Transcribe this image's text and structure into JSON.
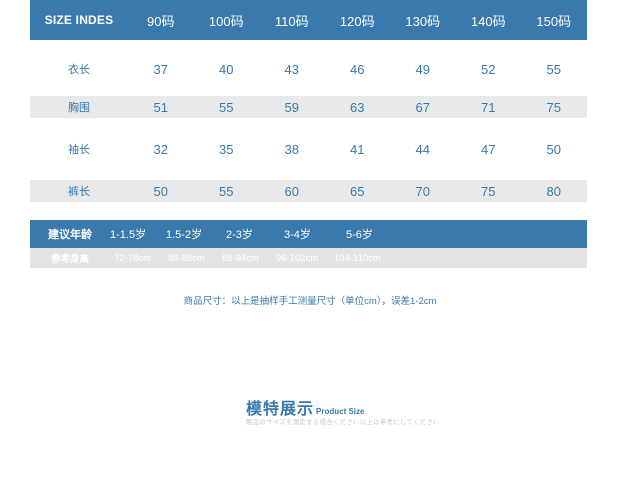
{
  "size_table": {
    "header": [
      "SIZE INDES",
      "90码",
      "100码",
      "110码",
      "120码",
      "130码",
      "140码",
      "150码"
    ],
    "rows": [
      {
        "label": "衣长",
        "values": [
          "37",
          "40",
          "43",
          "46",
          "49",
          "52",
          "55"
        ]
      },
      {
        "label": "胸围",
        "values": [
          "51",
          "55",
          "59",
          "63",
          "67",
          "71",
          "75"
        ]
      },
      {
        "label": "袖长",
        "values": [
          "32",
          "35",
          "38",
          "41",
          "44",
          "47",
          "50"
        ]
      },
      {
        "label": "裤长",
        "values": [
          "50",
          "55",
          "60",
          "65",
          "70",
          "75",
          "80"
        ]
      }
    ]
  },
  "age": {
    "label": "建议年龄",
    "values": [
      "1-1.5岁",
      "1.5-2岁",
      "2-3岁",
      "3-4岁",
      "5-6岁"
    ]
  },
  "height": {
    "label": "参考身高",
    "values": [
      "72-78cm",
      "80-88cm",
      "88-94cm",
      "96-102cm",
      "104-110cm"
    ]
  },
  "note": "商品尺寸：以上是抽样手工测量尺寸（单位cm），误差1-2cm",
  "model": {
    "title_cn": "模特展示",
    "title_en": "Product Size",
    "subtitle": "製品のサイズを測定する場合ください以上は参考にしてください"
  },
  "colors": {
    "accent": "#3a79ad",
    "row_grey": "#e8e9eb"
  }
}
